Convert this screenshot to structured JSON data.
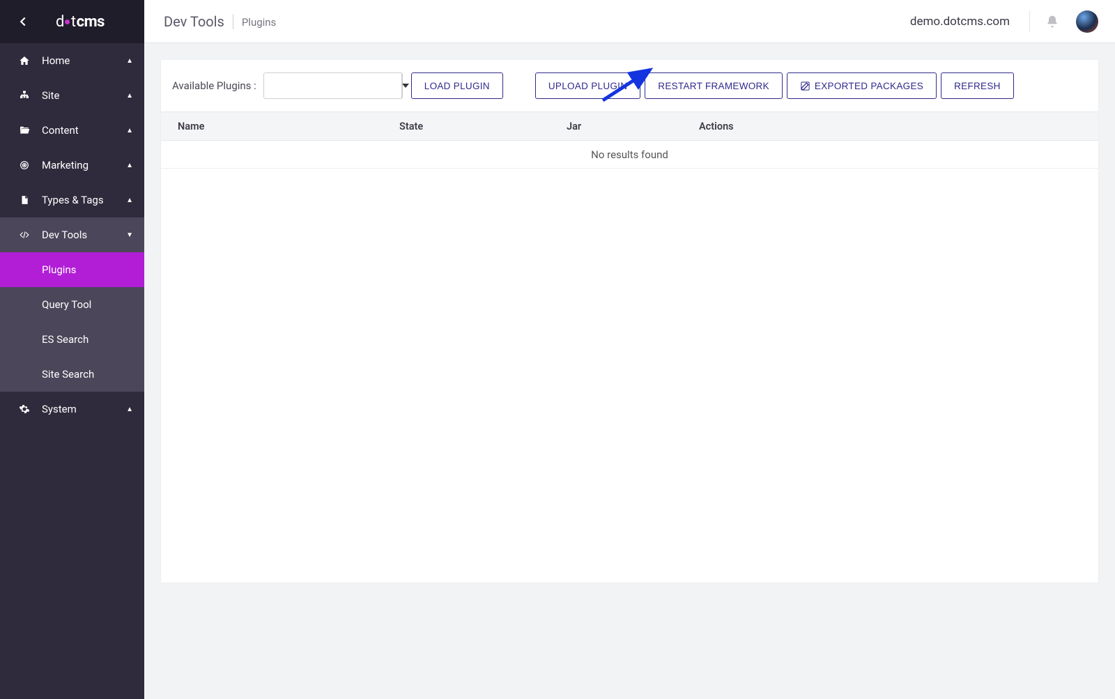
{
  "logo": {
    "text_d": "d",
    "text_t": "t",
    "text_cms": "cms"
  },
  "sidebar": {
    "items": [
      {
        "label": "Home"
      },
      {
        "label": "Site"
      },
      {
        "label": "Content"
      },
      {
        "label": "Marketing"
      },
      {
        "label": "Types & Tags"
      },
      {
        "label": "Dev Tools"
      },
      {
        "label": "System"
      }
    ],
    "devtools_sub": [
      {
        "label": "Plugins"
      },
      {
        "label": "Query Tool"
      },
      {
        "label": "ES Search"
      },
      {
        "label": "Site Search"
      }
    ]
  },
  "breadcrumb": {
    "section": "Dev Tools",
    "page": "Plugins"
  },
  "topbar": {
    "domain": "demo.dotcms.com"
  },
  "toolbar": {
    "available_label": "Available Plugins :",
    "combo_value": "",
    "load_plugin": "LOAD PLUGIN",
    "upload_plugin": "UPLOAD PLUGIN",
    "restart_framework": "RESTART FRAMEWORK",
    "exported_packages": "EXPORTED PACKAGES",
    "refresh": "REFRESH"
  },
  "table": {
    "headers": {
      "name": "Name",
      "state": "State",
      "jar": "Jar",
      "actions": "Actions"
    },
    "empty_message": "No results found"
  },
  "colors": {
    "accent_purple": "#b11ed6",
    "button_indigo": "#2f2a8c",
    "sidebar_dark": "#2f2b3c",
    "sidebar_darker": "#201d2b",
    "arrow_blue": "#1434e0"
  }
}
